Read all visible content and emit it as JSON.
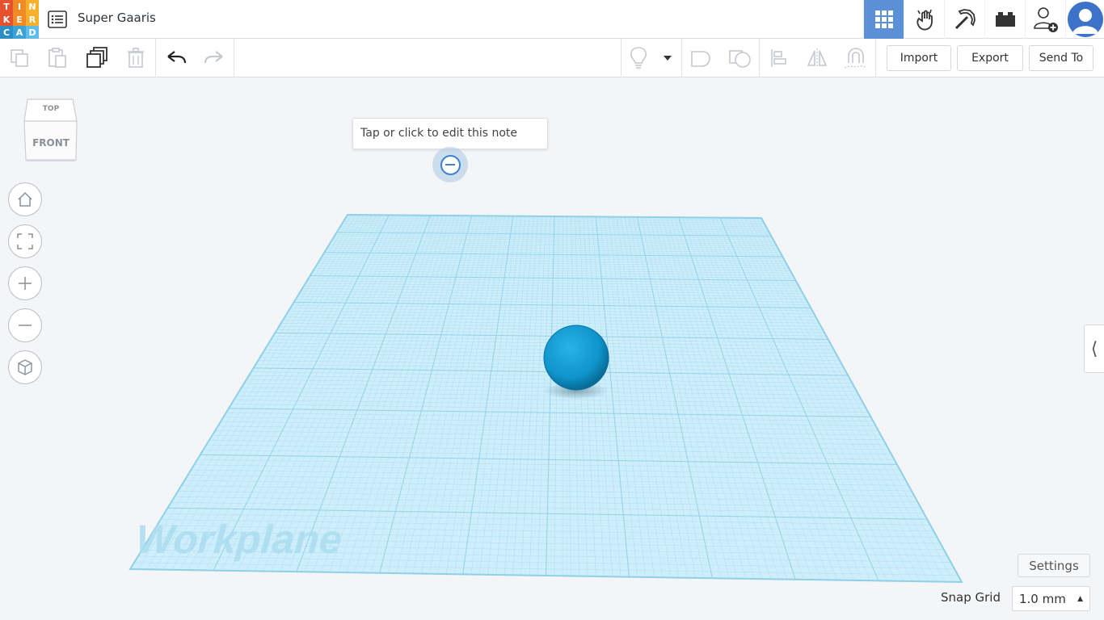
{
  "app": {
    "logo_letters": [
      "T",
      "I",
      "N",
      "K",
      "E",
      "R",
      "C",
      "A",
      "D"
    ],
    "logo_colors": [
      "#e8502f",
      "#f08a24",
      "#f6b02a",
      "#e8502f",
      "#f08a24",
      "#f6b02a",
      "#2b8ec7",
      "#3aa4d9",
      "#5fbde8"
    ],
    "title": "Super Gaaris",
    "accent": "#5b8fd6"
  },
  "header": {
    "buttons": [
      {
        "name": "3d-design-view",
        "icon": "grid-icon",
        "active": true
      },
      {
        "name": "circuits-view",
        "icon": "hand-icon",
        "active": false
      },
      {
        "name": "minecraft-view",
        "icon": "pickaxe-icon",
        "active": false
      },
      {
        "name": "lego-view",
        "icon": "brick-icon",
        "active": false
      },
      {
        "name": "add-user",
        "icon": "add-user-icon",
        "active": false
      },
      {
        "name": "profile",
        "icon": "avatar-icon",
        "active": false
      }
    ]
  },
  "toolbar": {
    "tools": [
      "copy",
      "paste",
      "duplicate",
      "delete",
      "undo",
      "redo"
    ],
    "right_tools": [
      "show-notes",
      "group",
      "ungroup",
      "align",
      "mirror",
      "cruise"
    ],
    "import_label": "Import",
    "export_label": "Export",
    "send_to_label": "Send To"
  },
  "viewcube": {
    "top_label": "TOP",
    "front_label": "FRONT"
  },
  "note": {
    "placeholder": "Tap or click to edit this note"
  },
  "workplane": {
    "label": "Workplane",
    "grid_color": "#8fd0e8",
    "fill_color": "#cdeefa",
    "sphere_color": "#1aa0d8"
  },
  "controls": {
    "settings_label": "Settings",
    "snap_grid_label": "Snap Grid",
    "snap_grid_value": "1.0 mm",
    "collapse_glyph": "⟨"
  }
}
